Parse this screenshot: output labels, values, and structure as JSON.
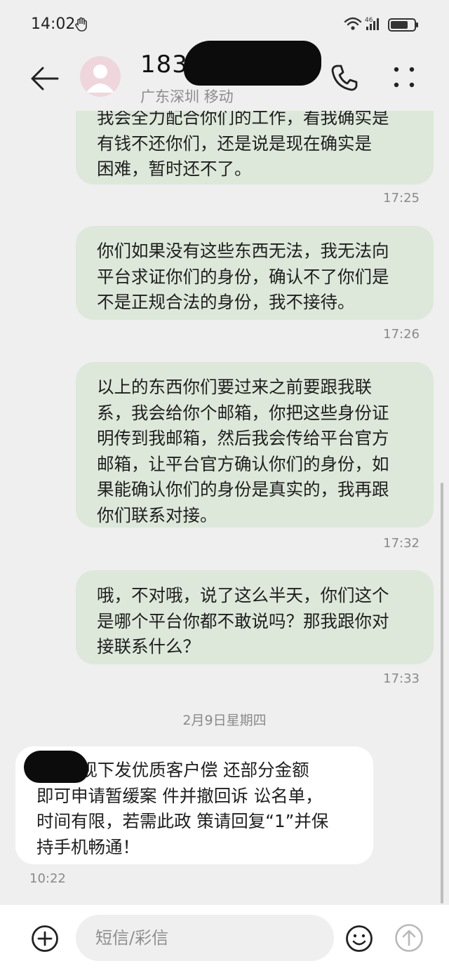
{
  "status_bar": {
    "time": "14:02",
    "network": "46"
  },
  "header": {
    "contact_name": "183",
    "location": "广东深圳 移动"
  },
  "messages": [
    {
      "type": "out",
      "text": "我会全力配合你们的工作，看我确实是\n有钱不还你们，还是说是现在确实是\n困难，暂时还不了。",
      "time": "17:25"
    },
    {
      "type": "out",
      "text": "你们如果没有这些东西无法，我无法向\n平台求证你们的身份，确认不了你们是\n不是正规合法的身份，我不接待。",
      "time": "17:26"
    },
    {
      "type": "out",
      "text": "以上的东西你们要过来之前要跟我联\n系，我会给你个邮箱，你把这些身份证\n明传到我邮箱，然后我会传给平台官方\n邮箱，让平台官方确认你们的身份，如\n果能确认你们的身份是真实的，我再跟\n你们联系对接。",
      "time": "17:32"
    },
    {
      "type": "out",
      "text": "哦，不对哦，说了这么半天，你们这个\n是哪个平台你都不敢说吗？那我跟你对\n接联系什么？",
      "time": "17:33"
    }
  ],
  "date_separator": "2月9日星期四",
  "incoming": {
    "text": "        现下发优质客户偿 还部分金额\n即可申请暂缓案 件并撤回诉 讼名单，\n时间有限，若需此政 策请回复“1”并保\n持手机畅通！",
    "time": "10:22"
  },
  "input": {
    "placeholder": "短信/彩信"
  }
}
